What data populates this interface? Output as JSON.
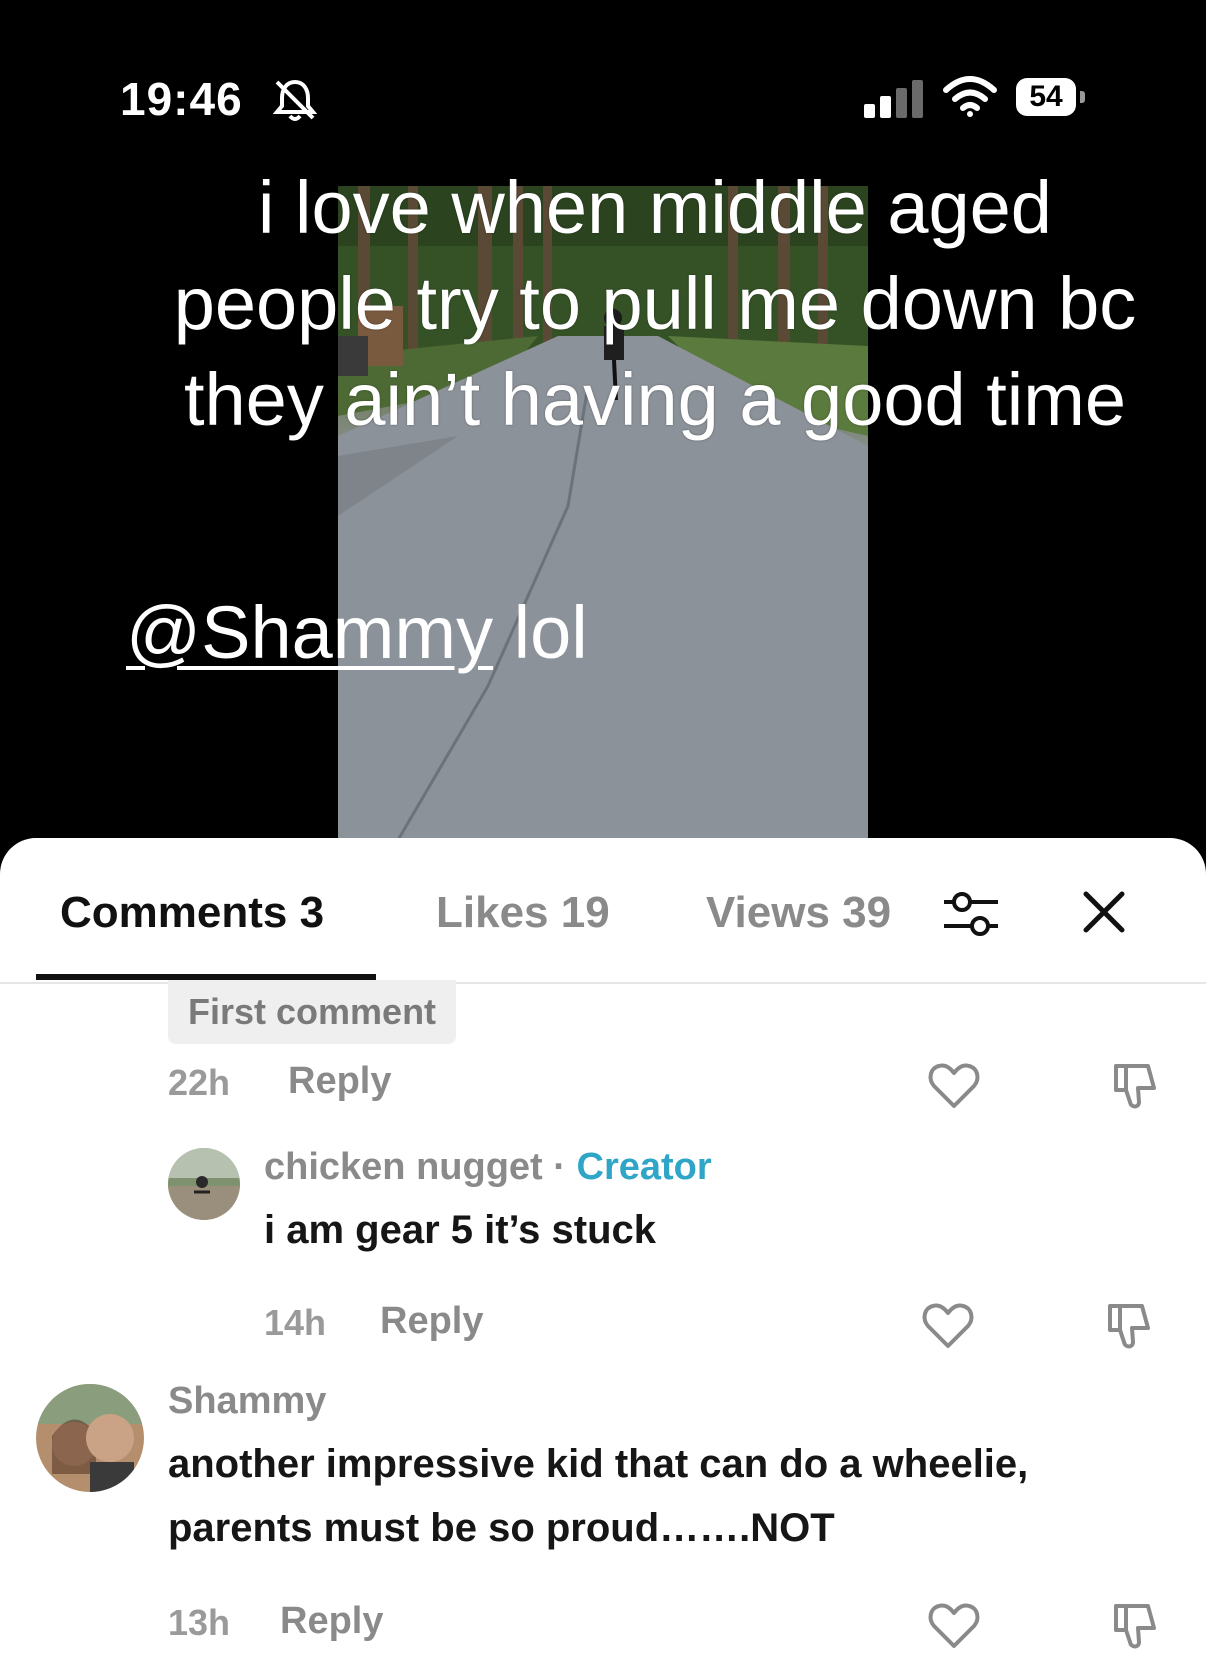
{
  "status_bar": {
    "time": "19:46",
    "battery": "54",
    "icons": [
      "bell-slash-icon",
      "signal-icon",
      "wifi-icon",
      "battery-icon"
    ]
  },
  "video": {
    "caption": "i love when middle aged people try to pull me down bc they ain’t having a good time",
    "mention": "@Shammy",
    "mention_suffix": " lol"
  },
  "tabs": {
    "comments": "Comments 3",
    "likes": "Likes 19",
    "views": "Views 39",
    "icons": [
      "filter-icon",
      "close-icon"
    ]
  },
  "comments": [
    {
      "badge": "First comment",
      "time": "22h",
      "reply": "Reply"
    },
    {
      "username": "chicken nugget",
      "separator": " · ",
      "role": "Creator",
      "text": "i am gear 5 it’s stuck",
      "time": "14h",
      "reply": "Reply"
    },
    {
      "username": "Shammy",
      "text": "another impressive kid that can do a wheelie, parents must be so proud…….NOT",
      "time": "13h",
      "reply": "Reply"
    }
  ],
  "colors": {
    "creator_accent": "#2fa6c7",
    "muted_text": "#8a8a8a",
    "primary_text": "#161616"
  }
}
